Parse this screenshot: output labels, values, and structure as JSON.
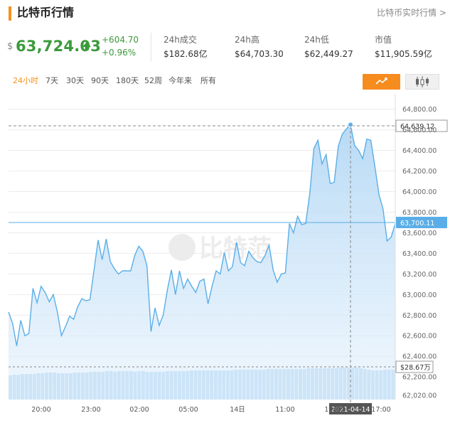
{
  "header": {
    "title": "比特币行情",
    "link": "比特币实时行情 >"
  },
  "price": {
    "currency_symbol": "$",
    "value": "63,724.03",
    "change_abs": "+604.70",
    "change_pct": "+0.96%",
    "trend": "up"
  },
  "stats": [
    {
      "label": "24h成交",
      "value": "$182.68亿"
    },
    {
      "label": "24h高",
      "value": "$64,703.30"
    },
    {
      "label": "24h低",
      "value": "$62,449.27"
    },
    {
      "label": "市值",
      "value": "$11,905.59亿"
    }
  ],
  "tabs": [
    "24小时",
    "7天",
    "30天",
    "90天",
    "180天",
    "52周",
    "今年来",
    "所有"
  ],
  "active_tab": "24小时",
  "chart_type_buttons": {
    "line": {
      "icon": "trend-line-icon",
      "active": true,
      "color": "#f68b1e"
    },
    "candle": {
      "icon": "candlestick-icon",
      "active": false
    }
  },
  "watermark": "比特范",
  "colors": {
    "up": "#3b9a3b",
    "accent": "#f3931f",
    "line": "#5aaee8",
    "volume": "#a9d1f2"
  },
  "chart_data": {
    "type": "area",
    "title": "",
    "xlabel": "",
    "ylabel": "",
    "ylim": [
      61980,
      64950
    ],
    "y_ticks": [
      "64,800.00",
      "64,600.00",
      "64,400.00",
      "64,200.00",
      "64,000.00",
      "63,800.00",
      "63,600.00",
      "63,400.00",
      "63,200.00",
      "63,000.00",
      "62,800.00",
      "62,600.00",
      "62,400.00",
      "62,200.00",
      "62,020.00"
    ],
    "x_ticks": [
      "20:00",
      "23:00",
      "02:00",
      "05:00",
      "14日",
      "11:00",
      "14:00",
      "17:00"
    ],
    "crosshair": {
      "date_label": "2021-04-14",
      "price_label": "64,639.12",
      "price": 64639.12
    },
    "current_price_label": "63,700.11",
    "current_price": 63700.11,
    "volume_label": "$28.67万",
    "series": [
      {
        "values": [
          62830,
          62720,
          62500,
          62750,
          62600,
          62620,
          63060,
          62920,
          63080,
          63020,
          62930,
          63000,
          62830,
          62600,
          62690,
          62790,
          62760,
          62880,
          62960,
          62940,
          62950,
          63240,
          63530,
          63340,
          63540,
          63320,
          63250,
          63200,
          63230,
          63230,
          63230,
          63380,
          63470,
          63420,
          63280,
          62640,
          62870,
          62700,
          62800,
          63040,
          63240,
          63000,
          63230,
          63060,
          63150,
          63080,
          63020,
          63130,
          63150,
          62910,
          63080,
          63230,
          63200,
          63410,
          63230,
          63270,
          63510,
          63310,
          63280,
          63420,
          63360,
          63320,
          63310,
          63380,
          63480,
          63240,
          63120,
          63200,
          63210,
          63690,
          63600,
          63760,
          63680,
          63690,
          63980,
          64420,
          64500,
          64270,
          64360,
          64080,
          64090,
          64440,
          64560,
          64610,
          64650,
          64450,
          64400,
          64320,
          64510,
          64500,
          64240,
          63970,
          63830,
          63520,
          63560,
          63690
        ]
      }
    ],
    "volume_series": [
      {
        "values": [
          34,
          35,
          35,
          36,
          36,
          36,
          36,
          37,
          37,
          38,
          38,
          38,
          37,
          37,
          37,
          37,
          38,
          38,
          38,
          38,
          39,
          39,
          39,
          39,
          40,
          40,
          39,
          40,
          40,
          40,
          40,
          39,
          40,
          40,
          39,
          39,
          39,
          39,
          39,
          40,
          40,
          40,
          40,
          40,
          40,
          41,
          41,
          41,
          41,
          41,
          41,
          41,
          41,
          41,
          41,
          41,
          42,
          42,
          42,
          42,
          42,
          42,
          42,
          42,
          43,
          43,
          43,
          43,
          43,
          43,
          43,
          43,
          43,
          43,
          44,
          44,
          44,
          44,
          44,
          44,
          44,
          44,
          45,
          45,
          45,
          45,
          45,
          44,
          43,
          42,
          41,
          41,
          41,
          42,
          42,
          42
        ]
      }
    ]
  }
}
